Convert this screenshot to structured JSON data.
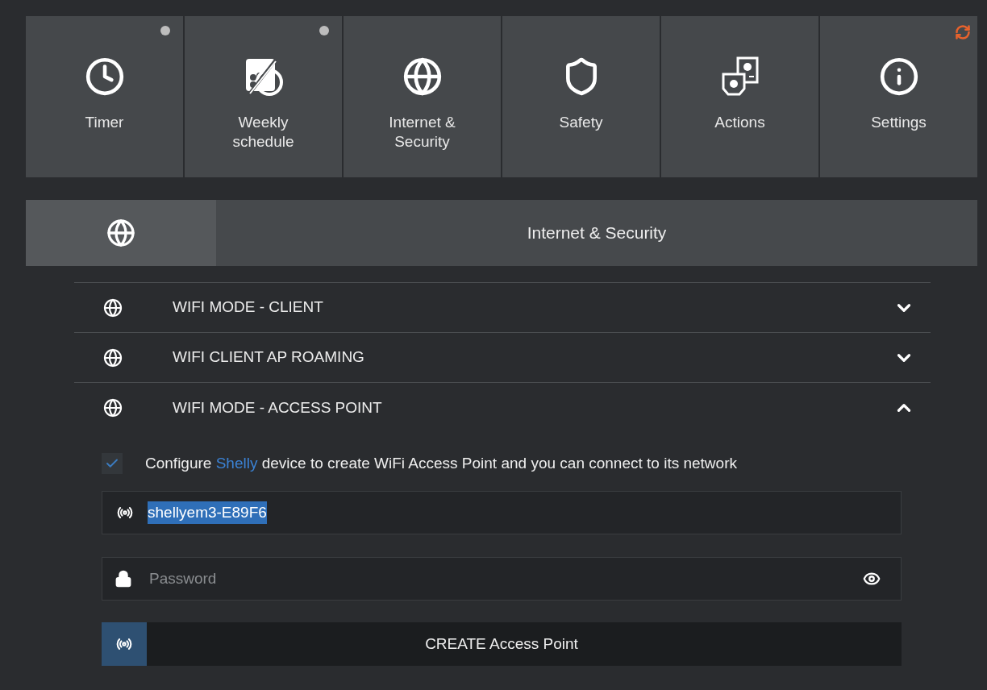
{
  "tiles": [
    {
      "label": "Timer",
      "kind": "dot"
    },
    {
      "label": "Weekly schedule",
      "kind": "dot"
    },
    {
      "label": "Internet & Security",
      "kind": "plain"
    },
    {
      "label": "Safety",
      "kind": "plain"
    },
    {
      "label": "Actions",
      "kind": "plain"
    },
    {
      "label": "Settings",
      "kind": "refresh"
    }
  ],
  "section": {
    "title": "Internet & Security"
  },
  "accordion": [
    {
      "title": "WIFI MODE - CLIENT",
      "expanded": false
    },
    {
      "title": "WIFI CLIENT AP ROAMING",
      "expanded": false
    },
    {
      "title": "WIFI MODE - ACCESS POINT",
      "expanded": true
    }
  ],
  "access_point": {
    "checkbox": {
      "checked": true,
      "text_before": "Configure ",
      "link": "Shelly",
      "text_after": " device to create WiFi Access Point and you can connect to its network"
    },
    "ssid": {
      "value": "shellyem3-E89F6",
      "highlighted": true
    },
    "password": {
      "placeholder": "Password"
    },
    "button": "CREATE Access Point"
  }
}
